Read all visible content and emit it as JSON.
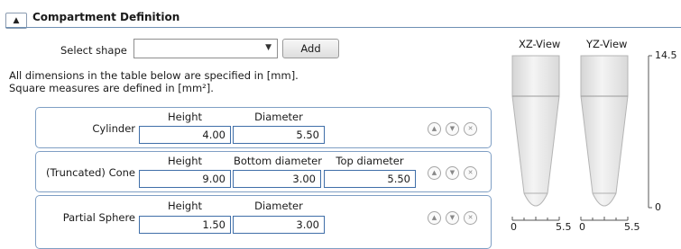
{
  "header": {
    "title": "Compartment Definition",
    "collapse_icon": "▲"
  },
  "toolbar": {
    "select_label": "Select shape",
    "select_value": "",
    "add_label": "Add"
  },
  "info": {
    "line1": "All dimensions in the table below are specified in [mm].",
    "line2": "Square measures are defined in [mm²]."
  },
  "shapes": [
    {
      "name": "Cylinder",
      "columns": [
        "Height",
        "Diameter"
      ],
      "values": [
        "4.00",
        "5.50"
      ]
    },
    {
      "name": "(Truncated) Cone",
      "columns": [
        "Height",
        "Bottom diameter",
        "Top diameter"
      ],
      "values": [
        "9.00",
        "3.00",
        "5.50"
      ]
    },
    {
      "name": "Partial Sphere",
      "columns": [
        "Height",
        "Diameter"
      ],
      "values": [
        "1.50",
        "3.00"
      ]
    }
  ],
  "controls": {
    "up_icon": "▲",
    "down_icon": "▼",
    "delete_icon": "✕"
  },
  "views": {
    "xz": {
      "label": "XZ-View",
      "x_ticks": [
        "0",
        "5.5"
      ]
    },
    "yz": {
      "label": "YZ-View",
      "x_ticks": [
        "0",
        "5.5"
      ]
    },
    "z_ticks": {
      "top": "14.5",
      "bottom": "0"
    }
  }
}
